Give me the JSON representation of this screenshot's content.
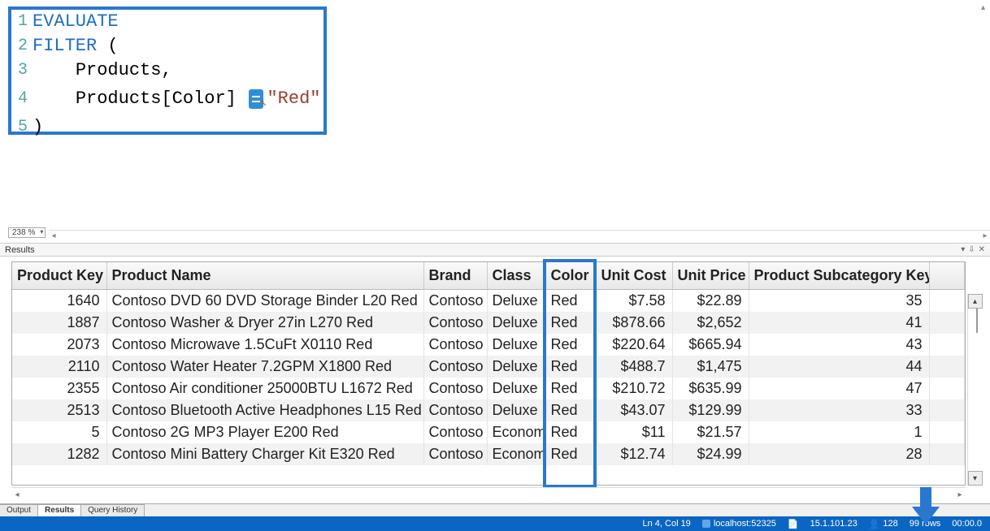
{
  "editor": {
    "lines": [
      {
        "num": "1",
        "kw": "EVALUATE",
        "rest": ""
      },
      {
        "num": "2",
        "kw": "FILTER",
        "rest": " ("
      },
      {
        "num": "3",
        "indent": "    ",
        "plain": "Products,",
        "rest": ""
      },
      {
        "num": "4",
        "indent": "    ",
        "plain": "Products[Color] ",
        "str": "\"Red\""
      },
      {
        "num": "5",
        "plain": ")"
      }
    ],
    "zoom": "238 %"
  },
  "results_panel_title": "Results",
  "columns": [
    "Product Key",
    "Product Name",
    "Brand",
    "Class",
    "Color",
    "Unit Cost",
    "Unit Price",
    "Product Subcategory Key"
  ],
  "rows": [
    {
      "key": "1640",
      "name": "Contoso DVD 60 DVD Storage Binder L20 Red",
      "brand": "Contoso",
      "class": "Deluxe",
      "color": "Red",
      "cost": "$7.58",
      "price": "$22.89",
      "sub": "35"
    },
    {
      "key": "1887",
      "name": "Contoso Washer & Dryer 27in L270 Red",
      "brand": "Contoso",
      "class": "Deluxe",
      "color": "Red",
      "cost": "$878.66",
      "price": "$2,652",
      "sub": "41"
    },
    {
      "key": "2073",
      "name": "Contoso Microwave 1.5CuFt X0110 Red",
      "brand": "Contoso",
      "class": "Deluxe",
      "color": "Red",
      "cost": "$220.64",
      "price": "$665.94",
      "sub": "43"
    },
    {
      "key": "2110",
      "name": "Contoso Water Heater 7.2GPM X1800 Red",
      "brand": "Contoso",
      "class": "Deluxe",
      "color": "Red",
      "cost": "$488.7",
      "price": "$1,475",
      "sub": "44"
    },
    {
      "key": "2355",
      "name": "Contoso Air conditioner 25000BTU L1672 Red",
      "brand": "Contoso",
      "class": "Deluxe",
      "color": "Red",
      "cost": "$210.72",
      "price": "$635.99",
      "sub": "47"
    },
    {
      "key": "2513",
      "name": "Contoso Bluetooth Active Headphones L15 Red",
      "brand": "Contoso",
      "class": "Deluxe",
      "color": "Red",
      "cost": "$43.07",
      "price": "$129.99",
      "sub": "33"
    },
    {
      "key": "5",
      "name": "Contoso 2G MP3 Player E200 Red",
      "brand": "Contoso",
      "class": "Economy",
      "color": "Red",
      "cost": "$11",
      "price": "$21.57",
      "sub": "1"
    },
    {
      "key": "1282",
      "name": "Contoso Mini Battery Charger Kit E320 Red",
      "brand": "Contoso",
      "class": "Economy",
      "color": "Red",
      "cost": "$12.74",
      "price": "$24.99",
      "sub": "28"
    }
  ],
  "tabs": {
    "output": "Output",
    "results": "Results",
    "history": "Query History"
  },
  "status": {
    "pos": "Ln 4, Col 19",
    "server": "localhost:52325",
    "ip": "15.1.101.23",
    "users": "128",
    "rows": "99 rows",
    "time": "00:00.0"
  }
}
